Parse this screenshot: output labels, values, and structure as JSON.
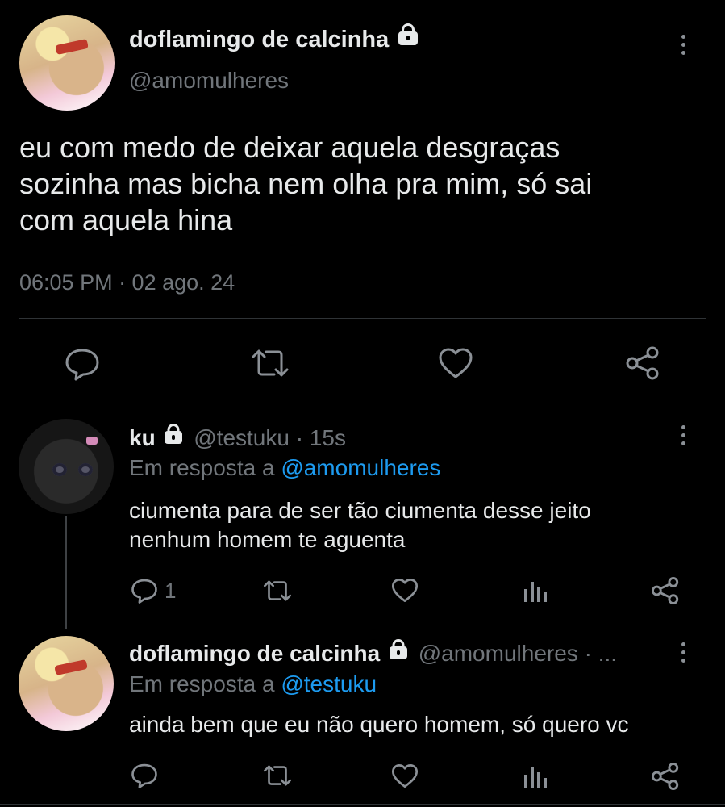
{
  "main_tweet": {
    "display_name": "doflamingo de calcinha",
    "handle": "@amomulheres",
    "text_lines": [
      "eu com medo de deixar aquela desgraças",
      "sozinha mas bicha nem olha pra mim, só sai",
      "com aquela hina"
    ],
    "timestamp": "06:05 PM · 02 ago. 24",
    "actions": [
      "reply-icon",
      "retweet-icon",
      "like-icon",
      "share-icon"
    ]
  },
  "reply_1": {
    "display_name": "ku",
    "handle_time": "@testuku · 15s",
    "in_reply_prefix": "Em resposta a ",
    "in_reply_handle": "@amomulheres",
    "text_lines": [
      "ciumenta para de ser tão ciumenta desse jeito",
      "nenhum homem te aguenta"
    ],
    "reply_count": "1"
  },
  "reply_2": {
    "display_name": "doflamingo de calcinha",
    "handle_time": "@amomulheres · ...",
    "in_reply_prefix": "Em resposta a ",
    "in_reply_handle": "@testuku",
    "text_lines": [
      "ainda bem que eu não quero homem, só quero vc"
    ]
  },
  "colors": {
    "background": "#000000",
    "text": "#e7e9ea",
    "muted": "#71767b",
    "link": "#1d9bf0",
    "divider": "#2f3336"
  }
}
